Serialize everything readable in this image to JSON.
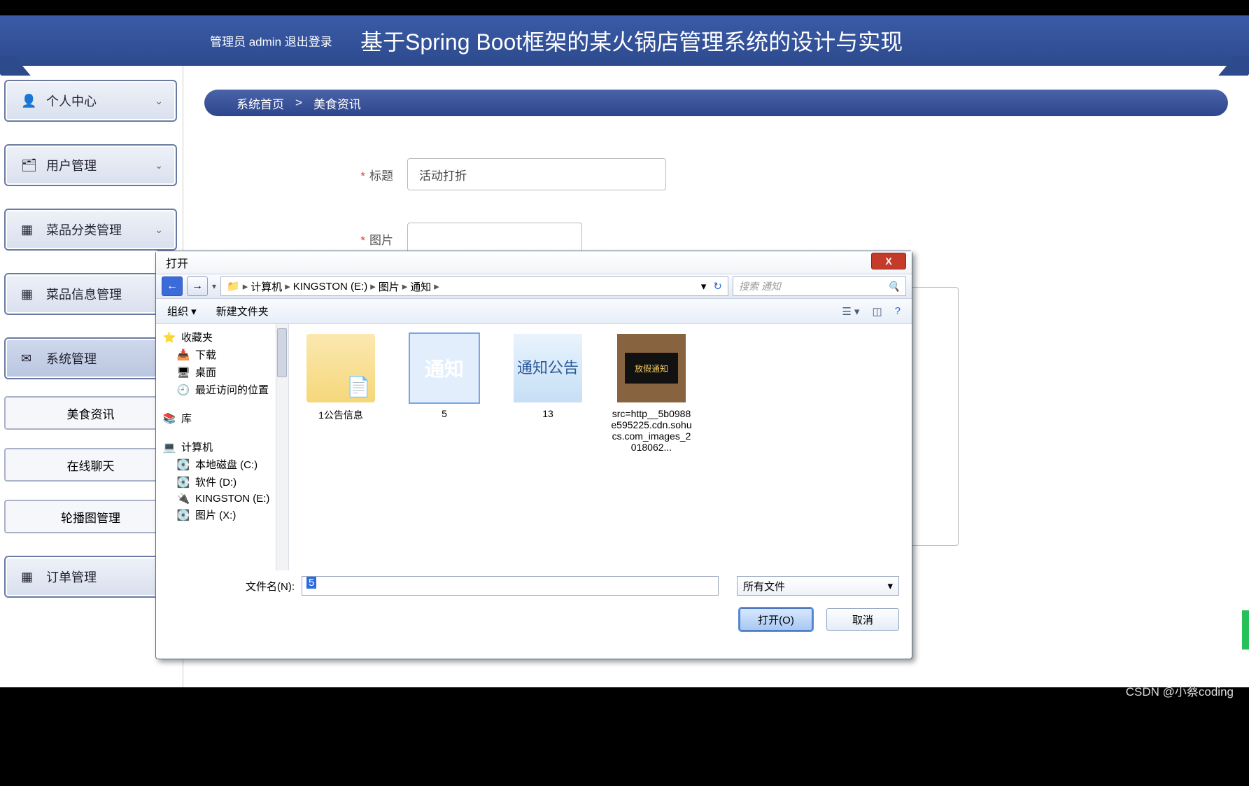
{
  "topbar": {
    "admin": "管理员 admin  退出登录",
    "title": "基于Spring Boot框架的某火锅店管理系统的设计与实现"
  },
  "sidebar": {
    "items": [
      {
        "icon": "👤",
        "label": "个人中心"
      },
      {
        "icon": "🗂",
        "label": "用户管理"
      },
      {
        "icon": "▦",
        "label": "菜品分类管理"
      },
      {
        "icon": "▦",
        "label": "菜品信息管理"
      },
      {
        "icon": "✉",
        "label": "系统管理"
      }
    ],
    "subitems": [
      "美食资讯",
      "在线聊天",
      "轮播图管理"
    ],
    "lastitem": {
      "icon": "▦",
      "label": "订单管理"
    }
  },
  "breadcrumb": {
    "a": "系统首页",
    "sep": ">",
    "b": "美食资讯"
  },
  "form": {
    "title_label": "标题",
    "title_value": "活动打折",
    "image_label": "图片"
  },
  "dialog": {
    "title": "打开",
    "path": [
      "计算机",
      "KINGSTON (E:)",
      "图片",
      "通知"
    ],
    "search_placeholder": "搜索 通知",
    "toolbar": {
      "org": "组织 ▾",
      "newf": "新建文件夹"
    },
    "side": {
      "fav": "收藏夹",
      "fav_items": [
        "下载",
        "桌面",
        "最近访问的位置"
      ],
      "lib": "库",
      "comp": "计算机",
      "comp_items": [
        "本地磁盘 (C:)",
        "软件 (D:)",
        "KINGSTON (E:)",
        "图片 (X:)"
      ]
    },
    "files": [
      {
        "name": "1公告信息",
        "kind": "folder"
      },
      {
        "name": "5",
        "kind": "orange",
        "txt": "通知"
      },
      {
        "name": "13",
        "kind": "sky",
        "txt": "通知公告"
      },
      {
        "name": "src=http__5b0988e595225.cdn.sohucs.com_images_2018062...",
        "kind": "photo",
        "txt": "放假通知"
      }
    ],
    "filename_label": "文件名(N):",
    "filename_value": "5",
    "filetype": "所有文件",
    "open_btn": "打开(O)",
    "cancel_btn": "取消"
  },
  "watermark": "CSDN @小蔡coding"
}
